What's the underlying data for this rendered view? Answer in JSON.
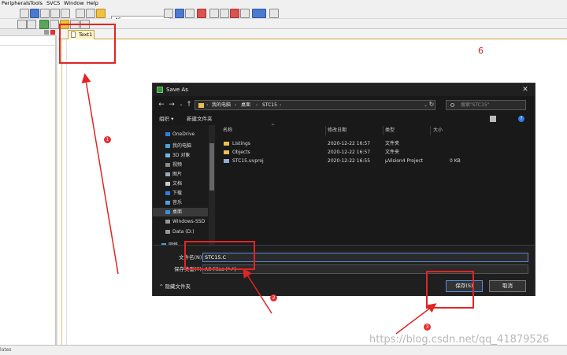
{
  "menu": {
    "items": [
      "Peripherals",
      "Tools",
      "SVCS",
      "Window",
      "Help"
    ]
  },
  "toolbar": {
    "target": "AS"
  },
  "editor": {
    "tab_label": "Text1"
  },
  "annotation": {
    "step_six": "6",
    "steps": [
      "1",
      "2",
      "3"
    ]
  },
  "statusbar": {
    "text": "lates"
  },
  "dialog": {
    "title": "Save As",
    "address": [
      "我的电脑",
      "桌面",
      "STC15"
    ],
    "search_placeholder": "搜索\"STC15\"",
    "cmd": {
      "organize": "组织 ▾",
      "new_folder": "新建文件夹"
    },
    "nav_items": [
      "OneDrive",
      "我的电脑",
      "3D 对象",
      "视频",
      "图片",
      "文档",
      "下载",
      "音乐",
      "桌面",
      "Windows-SSD",
      "Data (D:)",
      "网络"
    ],
    "columns": {
      "name": "名称",
      "date": "修改日期",
      "type": "类型",
      "size": "大小"
    },
    "files": [
      {
        "name": "Listings",
        "date": "2020-12-22 16:57",
        "type": "文件夹",
        "size": ""
      },
      {
        "name": "Objects",
        "date": "2020-12-22 16:57",
        "type": "文件夹",
        "size": ""
      },
      {
        "name": "STC15.uvproj",
        "date": "2020-12-22 16:55",
        "type": "µVision4 Project",
        "size": "0 KB"
      }
    ],
    "filename_label": "文件名(N):",
    "filename_value": "STC15.C",
    "filetype_label": "保存类型(T):",
    "filetype_value": "All Files (*.*)",
    "hide_folders": "隐藏文件夹",
    "save_button": "保存(S)",
    "cancel_button": "取消"
  },
  "watermark": "https://blog.csdn.net/qq_41879526"
}
